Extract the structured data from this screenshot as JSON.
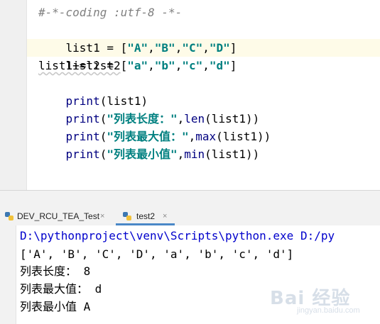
{
  "editor": {
    "lines": {
      "l1": "#-*-coding :utf-8 -*-",
      "l2a": "list1 = [",
      "l2s1": "\"A\"",
      "l2s2": "\"B\"",
      "l2s3": "\"C\"",
      "l2s4": "\"D\"",
      "l3a": "list2 = [",
      "l3s1": "\"a\"",
      "l3s2": "\"b\"",
      "l3s3": "\"c\"",
      "l3s4": "\"d\"",
      "comma": ",",
      "close": "]",
      "l4": "list1+=list2",
      "print": "print",
      "l5b": "(list1)",
      "l6s": "\"列表长度：\"",
      "l6f": "len",
      "l6r": "(list1))",
      "l7s": "\"列表最大值：\"",
      "l7f": "max",
      "l7r": "(list1))",
      "l8s": "\"列表最小值\"",
      "l8f": "min",
      "l8r": "(list1))",
      "open": "(",
      "sep": ","
    }
  },
  "tabs": [
    {
      "label": "DEV_RCU_TEA_Test",
      "close": "×",
      "icon": "python-icon"
    },
    {
      "label": "test2",
      "close": "×",
      "icon": "python-icon"
    }
  ],
  "console": {
    "cmd": "D:\\pythonproject\\venv\\Scripts\\python.exe D:/py",
    "list_out": "['A', 'B', 'C', 'D', 'a', 'b', 'c', 'd']",
    "len_label": "列表长度：",
    "len_val": " 8",
    "max_label": "列表最大值：",
    "max_val": " d",
    "min_label": "列表最小值",
    "min_val": " A"
  },
  "watermark": {
    "text": "Bai 经验",
    "sub": "jingyan.baidu.com"
  },
  "colors": {
    "keyword": "#000080",
    "string": "#008080",
    "path": "#0000cc",
    "highlight": "#fefbe8"
  }
}
